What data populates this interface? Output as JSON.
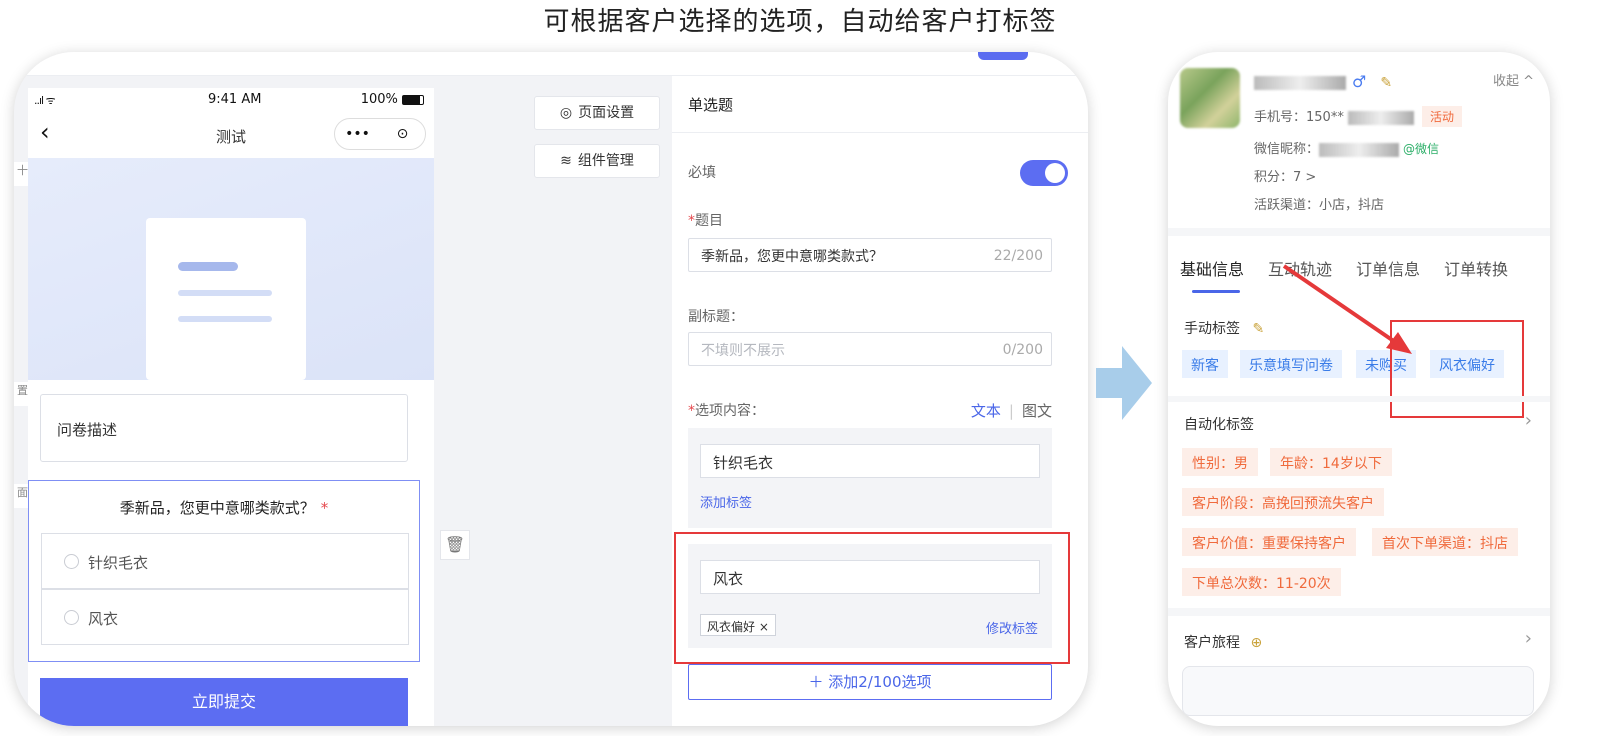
{
  "header": {
    "title": "可根据客户选择的选项，自动给客户打标签"
  },
  "phone": {
    "signal": "..ıl ᯤ",
    "time": "9:41 AM",
    "battery": "100%",
    "back_icon": "‹",
    "page_title": "测试",
    "more_icon": "•••",
    "record_icon": "⊙",
    "description": "问卷描述",
    "question": "季新品，您更中意哪类款式？",
    "required_mark": "*",
    "options": [
      "针织毛衣",
      "风衣"
    ],
    "submit": "立即提交",
    "side_labels": [
      "十",
      "置",
      "面"
    ]
  },
  "middle": {
    "page_settings": "页面设置",
    "component_manage": "组件管理",
    "page_settings_icon": "◎",
    "component_icon": "≋"
  },
  "config": {
    "header": "单选题",
    "required_label": "必填",
    "title_label": "题目",
    "title_value": "季新品，您更中意哪类款式？",
    "title_count": "22/200",
    "subtitle_label": "副标题：",
    "subtitle_placeholder": "不填则不展示",
    "subtitle_count": "0/200",
    "options_label": "选项内容：",
    "mode_text": "文本",
    "mode_image": "图文",
    "options": [
      {
        "value": "针织毛衣",
        "add_tag": "添加标签"
      },
      {
        "value": "风衣",
        "tag": "风衣偏好",
        "tag_close": "×",
        "modify_tag": "修改标签"
      }
    ],
    "add_option": "＋ 添加2/100选项"
  },
  "profile": {
    "fold": "收起 ^",
    "male_icon": "♂",
    "edit_icon": "✎",
    "phone_label": "手机号：150**",
    "active_badge": "活动",
    "wechat_label": "微信昵称：",
    "wechat_suffix": "@微信",
    "points": "积分：7 >",
    "channels": "活跃渠道：小店，抖店",
    "tabs": [
      "基础信息",
      "互动轨迹",
      "订单信息",
      "订单转换"
    ],
    "manual_tags_label": "手动标签",
    "manual_tags": [
      "新客",
      "乐意填写问卷",
      "未购买",
      "风衣偏好"
    ],
    "auto_tags_label": "自动化标签",
    "auto_tags": [
      "性别：男",
      "年龄：14岁以下",
      "客户阶段：高挽回预流失客户",
      "客户价值：重要保持客户",
      "首次下单渠道：抖店",
      "下单总次数：11-20次"
    ],
    "journey_label": "客户旅程",
    "journey_icon": "⊕",
    "chevron": "›"
  },
  "colors": {
    "accent": "#5c6df2",
    "highlight": "#e5393a",
    "tag_blue_bg": "#e8f1ff",
    "tag_orange_bg": "#fdeee8"
  }
}
